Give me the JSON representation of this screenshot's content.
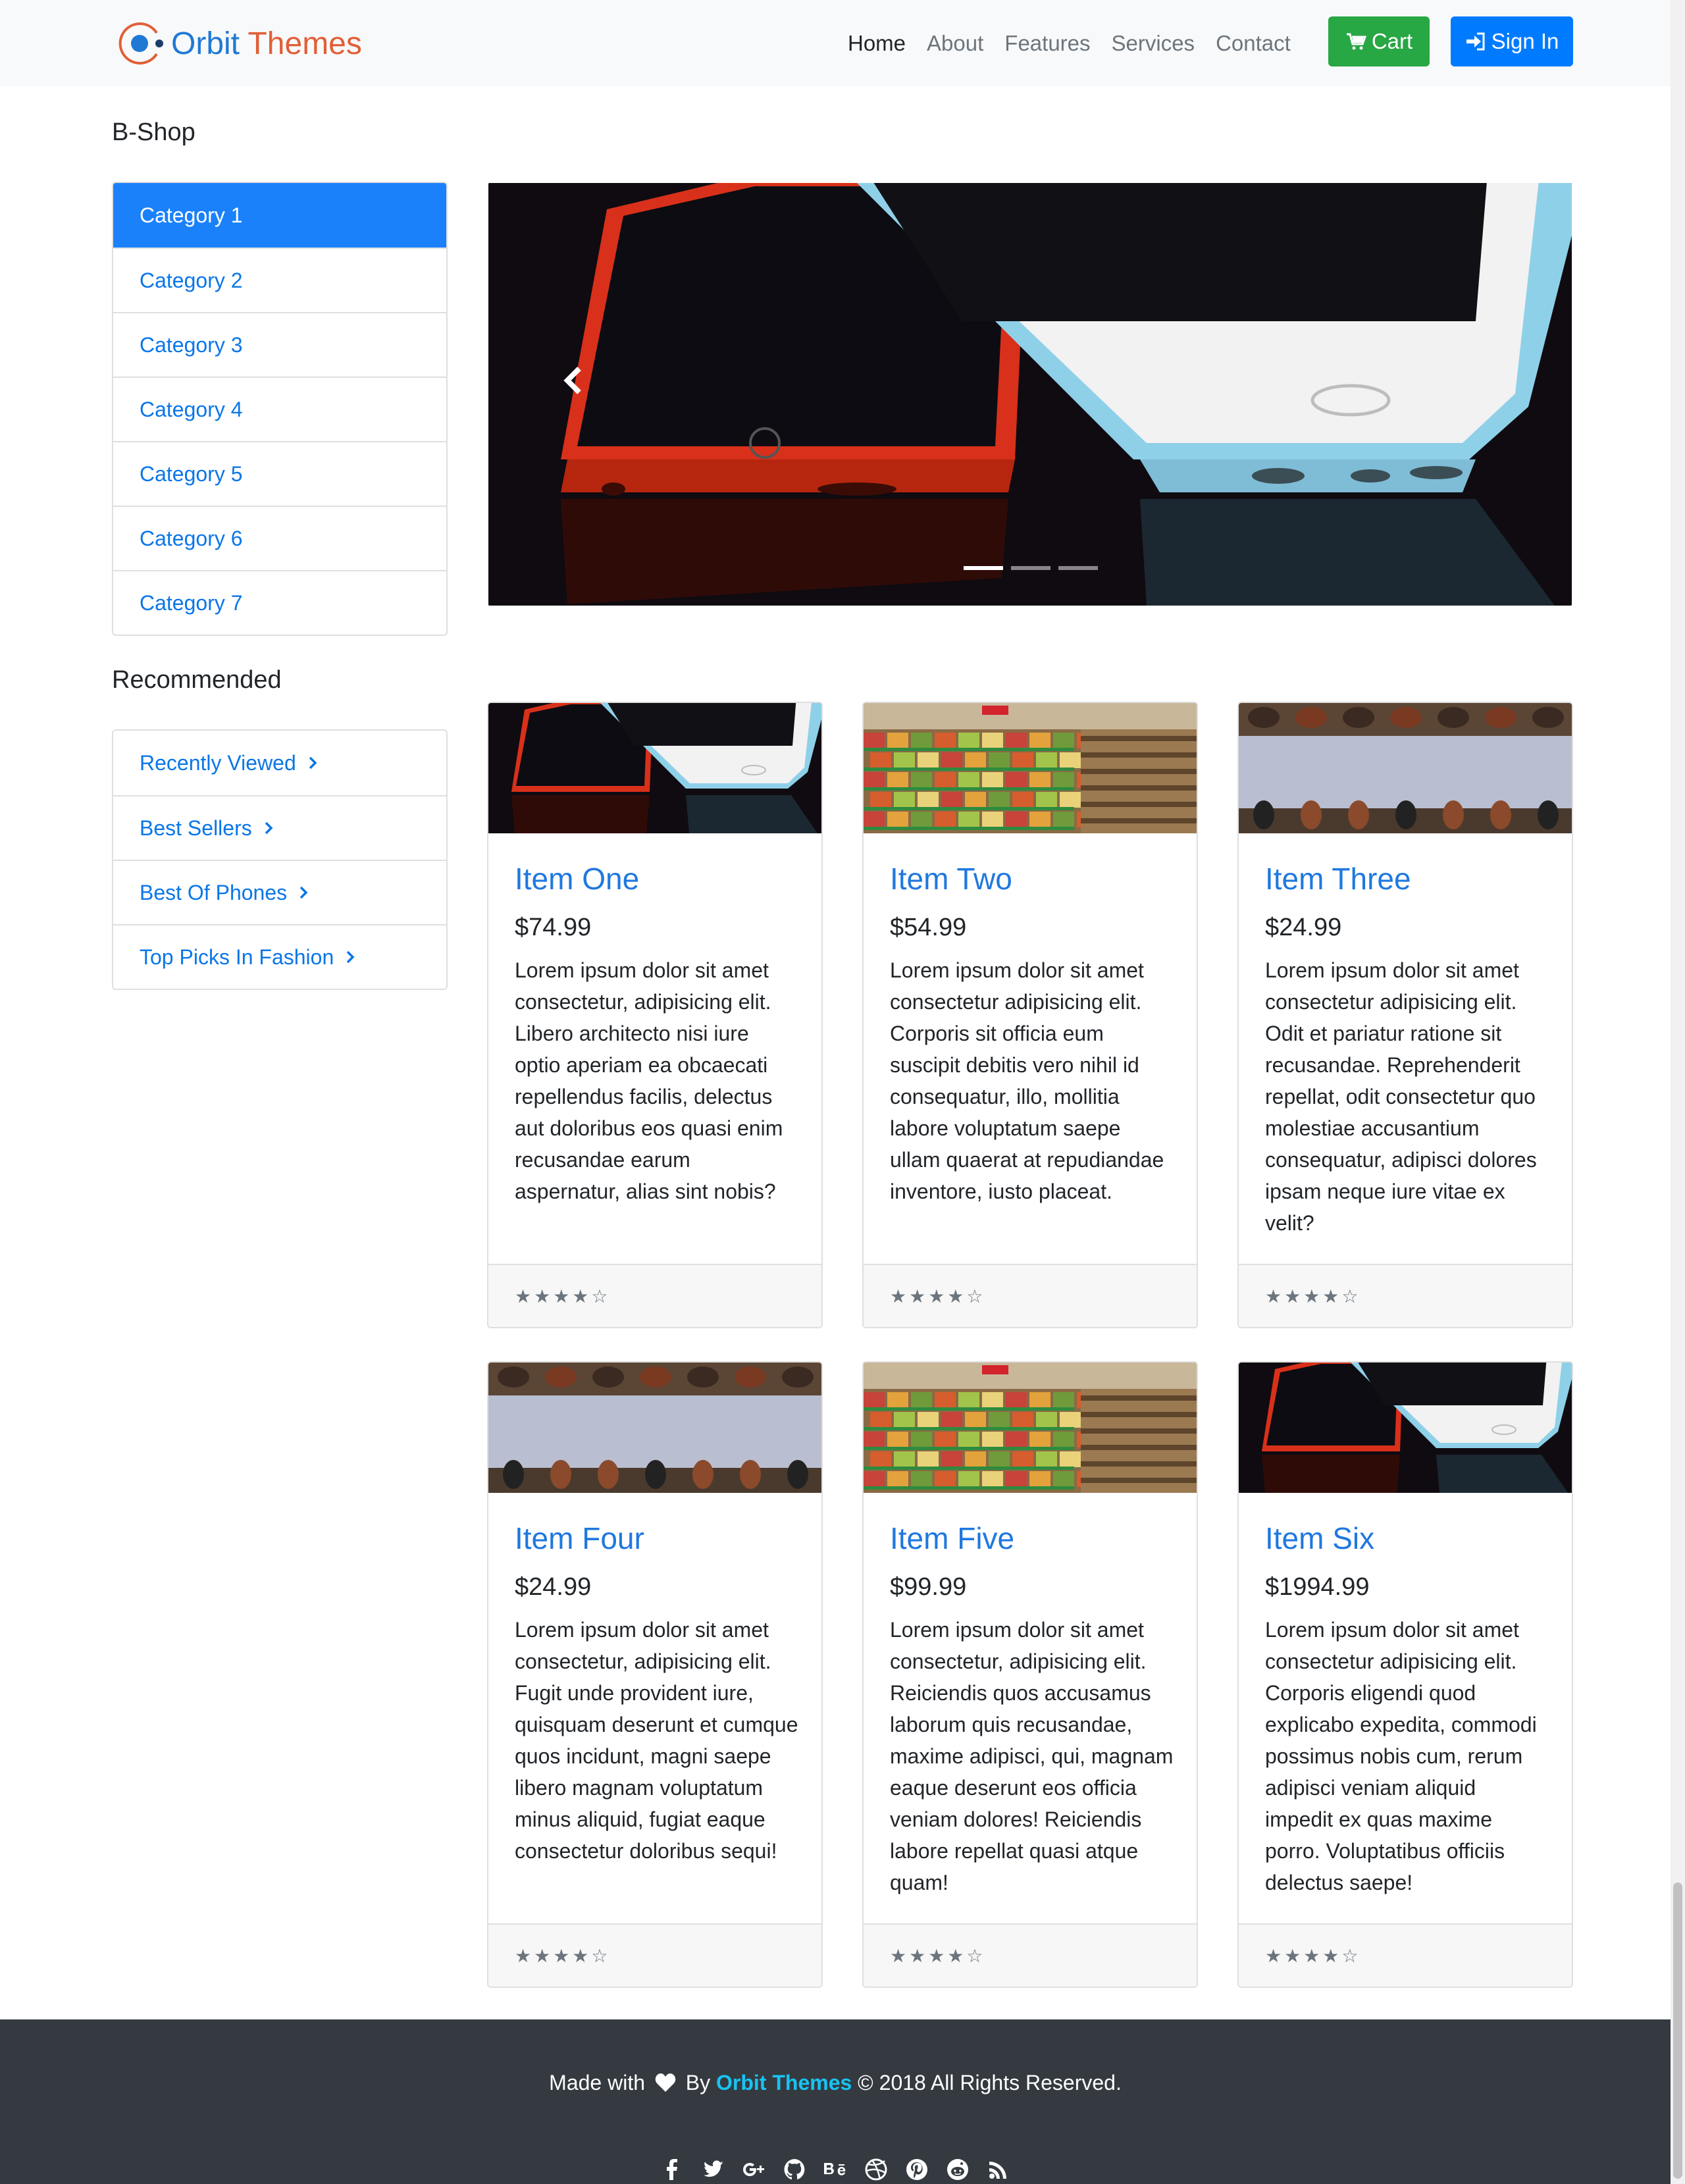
{
  "navbar": {
    "brand_first": "Orbit",
    "brand_second": "Themes",
    "links": [
      "Home",
      "About",
      "Features",
      "Services",
      "Contact"
    ],
    "active_link": "Home",
    "cart_label": "Cart",
    "signin_label": "Sign In"
  },
  "sidebar": {
    "shop_title": "B-Shop",
    "categories": [
      "Category 1",
      "Category 2",
      "Category 3",
      "Category 4",
      "Category 5",
      "Category 6",
      "Category 7"
    ],
    "active_category": "Category 1",
    "recommended_title": "Recommended",
    "recommended": [
      "Recently Viewed",
      "Best Sellers",
      "Best Of Phones",
      "Top Picks In Fashion"
    ]
  },
  "carousel": {
    "slide_count": 3,
    "active_slide": 1
  },
  "products": [
    {
      "title": "Item One",
      "price": "$74.99",
      "description": "Lorem ipsum dolor sit amet consectetur, adipisicing elit. Libero architecto nisi iure optio aperiam ea obcaecati repellendus facilis, delectus aut doloribus eos quasi enim recusandae earum aspernatur, alias sint nobis?",
      "rating": "★★★★☆",
      "rating_value": 4,
      "image": "phones"
    },
    {
      "title": "Item Two",
      "price": "$54.99",
      "description": "Lorem ipsum dolor sit amet consectetur adipisicing elit. Corporis sit officia eum suscipit debitis vero nihil id consequatur, illo, mollitia labore voluptatum saepe ullam quaerat at repudiandae inventore, iusto placeat.",
      "rating": "★★★★☆",
      "rating_value": 4,
      "image": "market"
    },
    {
      "title": "Item Three",
      "price": "$24.99",
      "description": "Lorem ipsum dolor sit amet consectetur adipisicing elit. Odit et pariatur ratione sit recusandae. Reprehenderit repellat, odit consectetur quo molestiae accusantium consequatur, adipisci dolores ipsam neque iure vitae ex velit?",
      "rating": "★★★★☆",
      "rating_value": 4,
      "image": "shoes"
    },
    {
      "title": "Item Four",
      "price": "$24.99",
      "description": "Lorem ipsum dolor sit amet consectetur, adipisicing elit. Fugit unde provident iure, quisquam deserunt et cumque quos incidunt, magni saepe libero magnam voluptatum minus aliquid, fugiat eaque consectetur doloribus sequi!",
      "rating": "★★★★☆",
      "rating_value": 4,
      "image": "shoes"
    },
    {
      "title": "Item Five",
      "price": "$99.99",
      "description": "Lorem ipsum dolor sit amet consectetur, adipisicing elit. Reiciendis quos accusamus laborum quis recusandae, maxime adipisci, qui, magnam eaque deserunt eos officia veniam dolores! Reiciendis labore repellat quasi atque quam!",
      "rating": "★★★★☆",
      "rating_value": 4,
      "image": "market"
    },
    {
      "title": "Item Six",
      "price": "$1994.99",
      "description": "Lorem ipsum dolor sit amet consectetur adipisicing elit. Corporis eligendi quod explicabo expedita, commodi possimus nobis cum, rerum adipisci veniam aliquid impedit ex quas maxime porro. Voluptatibus officiis delectus saepe!",
      "rating": "★★★★☆",
      "rating_value": 4,
      "image": "phones"
    }
  ],
  "footer": {
    "made_with": "Made with",
    "by": "By",
    "brand": "Orbit Themes",
    "rights": "© 2018 All Rights Reserved.",
    "social_icons": [
      "facebook-icon",
      "twitter-icon",
      "google-plus-icon",
      "github-icon",
      "behance-icon",
      "dribbble-icon",
      "pinterest-icon",
      "reddit-icon",
      "rss-icon"
    ]
  },
  "colors": {
    "primary": "#007bff",
    "success": "#28a745",
    "brand_blue": "#1f79d4",
    "brand_orange": "#e15f37",
    "footer_bg": "#343a40",
    "footer_brand": "#17c3f2"
  }
}
